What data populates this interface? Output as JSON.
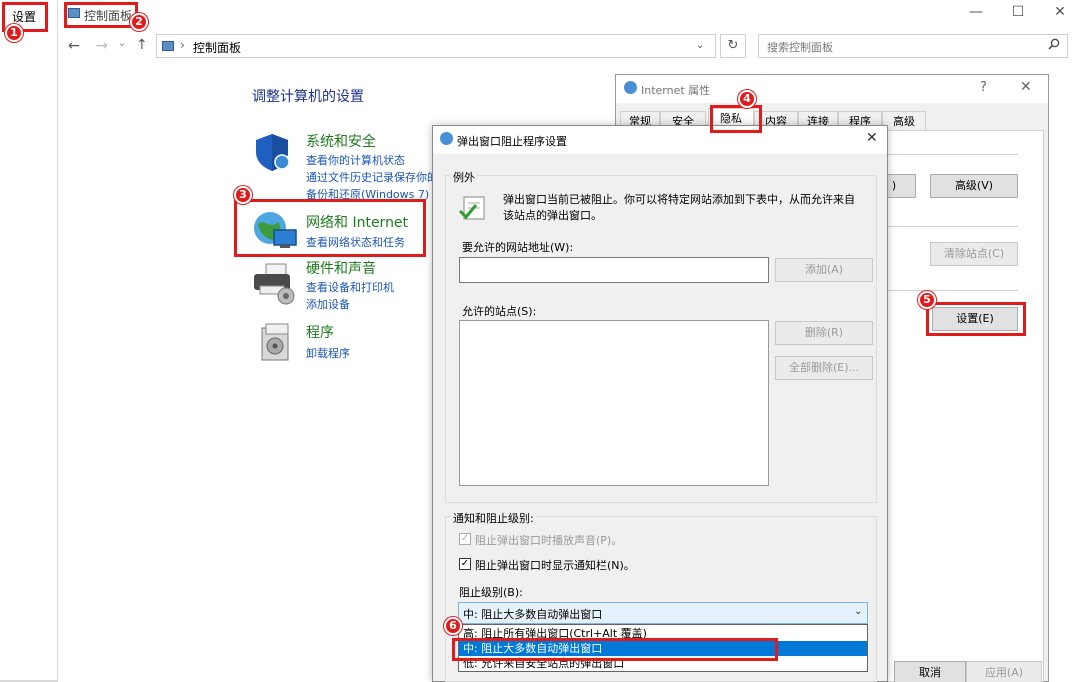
{
  "settings": {
    "title": "设置"
  },
  "control_panel": {
    "title": "控制面板",
    "window_controls": {
      "minimize": "—",
      "maximize": "☐",
      "close": "✕"
    },
    "nav": {
      "back": "←",
      "forward": "→",
      "down": "⌄",
      "up": "↑"
    },
    "address": {
      "separator": "›",
      "path": "控制面板",
      "dropdown": "⌄",
      "refresh": "↻"
    },
    "search": {
      "placeholder": "搜索控制面板",
      "icon": "search-icon"
    },
    "heading": "调整计算机的设置",
    "categories": [
      {
        "title": "系统和安全",
        "links": [
          "查看你的计算机状态",
          "通过文件历史记录保存你的",
          "备份和还原(Windows 7)"
        ],
        "icon": "shield-icon"
      },
      {
        "title": "网络和 Internet",
        "links": [
          "查看网络状态和任务"
        ],
        "icon": "network-globe-icon"
      },
      {
        "title": "硬件和声音",
        "links": [
          "查看设备和打印机",
          "添加设备"
        ],
        "icon": "printer-icon"
      },
      {
        "title": "程序",
        "links": [
          "卸载程序"
        ],
        "icon": "programs-icon"
      }
    ]
  },
  "internet_properties": {
    "title": "Internet 属性",
    "help": "?",
    "close": "✕",
    "tabs": [
      "常规",
      "安全",
      "隐私",
      "内容",
      "连接",
      "程序",
      "高级"
    ],
    "buttons": {
      "partial": ")",
      "advanced": "高级(V)",
      "clear_sites": "清除站点(C)",
      "settings": "设置(E)",
      "cancel": "取消",
      "apply": "应用(A)"
    }
  },
  "popup_blocker": {
    "title": "弹出窗口阻止程序设置",
    "close": "✕",
    "exceptions": {
      "group_label": "例外",
      "description": "弹出窗口当前已被阻止。你可以将特定网站添加到下表中，从而允许来自该站点的弹出窗口。",
      "address_label": "要允许的网站地址(W):",
      "address_value": "",
      "add_button": "添加(A)",
      "allowed_label": "允许的站点(S):",
      "remove_button": "删除(R)",
      "remove_all_button": "全部删除(E)..."
    },
    "notifications": {
      "group_label": "通知和阻止级别:",
      "play_sound": "阻止弹出窗口时播放声音(P)。",
      "show_bar": "阻止弹出窗口时显示通知栏(N)。",
      "level_label": "阻止级别(B):",
      "selected_level": "中: 阻止大多数自动弹出窗口",
      "options": [
        "高: 阻止所有弹出窗口(Ctrl+Alt 覆盖)",
        "中: 阻止大多数自动弹出窗口",
        "低: 允许来自安全站点的弹出窗口"
      ]
    }
  },
  "annotations": [
    "1",
    "2",
    "3",
    "4",
    "5",
    "6"
  ],
  "colors": {
    "annotation": "#e01b1b",
    "selection": "#0078d7",
    "link": "#1a56b8",
    "category": "#1e7b1e"
  }
}
